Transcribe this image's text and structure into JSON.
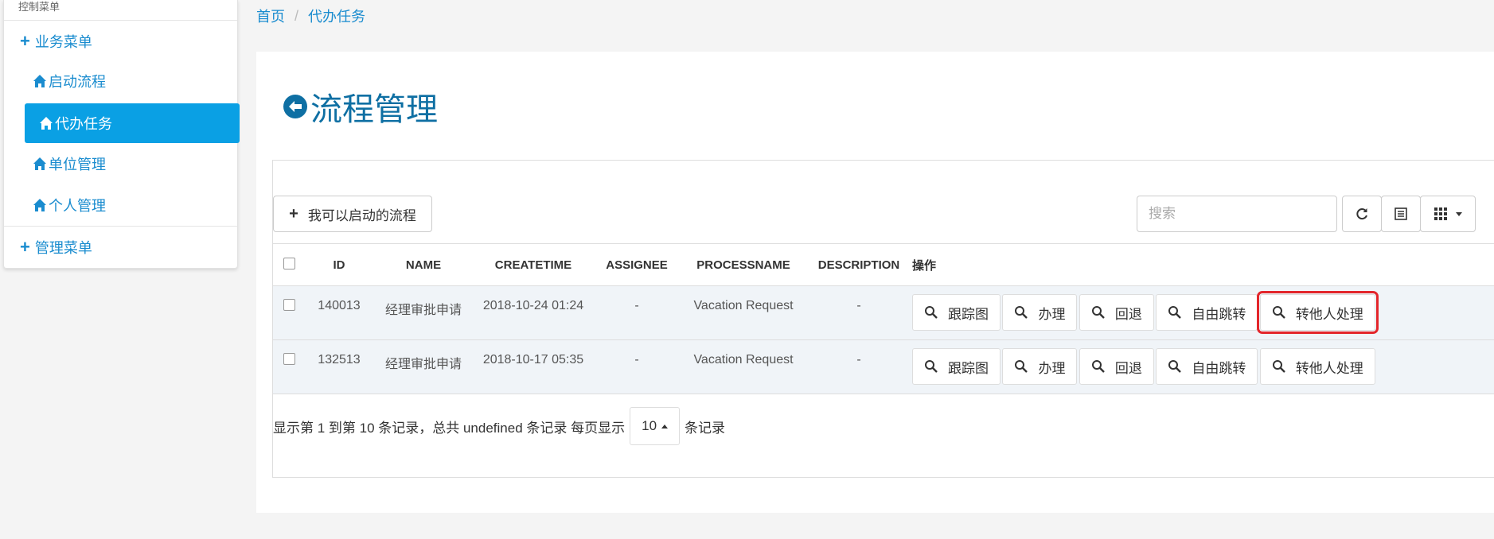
{
  "sidebar": {
    "caption": "控制菜单",
    "group_business": "业务菜单",
    "items": [
      {
        "label": "启动流程"
      },
      {
        "label": "代办任务"
      },
      {
        "label": "单位管理"
      },
      {
        "label": "个人管理"
      }
    ],
    "group_admin": "管理菜单"
  },
  "breadcrumb": {
    "home": "首页",
    "separator": "/",
    "current": "代办任务"
  },
  "page": {
    "title": "流程管理"
  },
  "toolbar": {
    "add_label": "我可以启动的流程",
    "search_placeholder": "搜索"
  },
  "table": {
    "headers": [
      "ID",
      "NAME",
      "CREATETIME",
      "ASSIGNEE",
      "PROCESSNAME",
      "DESCRIPTION",
      "操作"
    ],
    "rows": [
      {
        "id": "140013",
        "name": "经理审批申请",
        "createtime": "2018-10-24 01:24",
        "assignee": "-",
        "processname": "Vacation Request",
        "description": "-"
      },
      {
        "id": "132513",
        "name": "经理审批申请",
        "createtime": "2018-10-17 05:35",
        "assignee": "-",
        "processname": "Vacation Request",
        "description": "-"
      }
    ],
    "actions": [
      "跟踪图",
      "办理",
      "回退",
      "自由跳转",
      "转他人处理"
    ]
  },
  "pager": {
    "summary": "显示第 1 到第 10 条记录，总共 undefined 条记录 每页显示",
    "page_size": "10",
    "suffix": "条记录"
  }
}
